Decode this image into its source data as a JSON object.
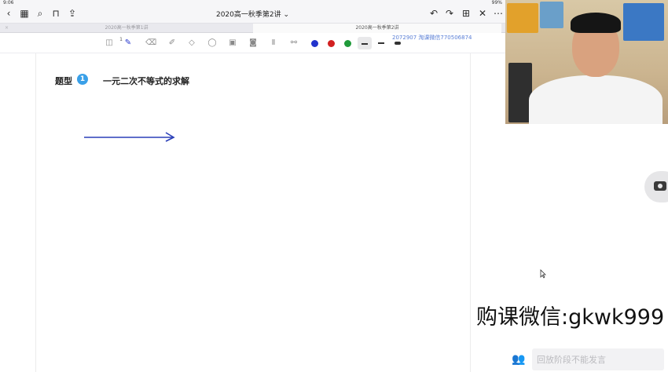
{
  "status": {
    "time": "9:06",
    "battery": "99%"
  },
  "nav": {
    "back_icon": "chevron-left-icon",
    "doc_title": "2020高一秋季第2讲 ⌄"
  },
  "tabs": [
    {
      "label": "2020高一秋季第1讲",
      "close": "×"
    },
    {
      "label": "2020高一秋季第2讲"
    }
  ],
  "toolbar": {
    "badge": "1",
    "colors": [
      "#2233cc",
      "#d22020",
      "#1f9a3a"
    ],
    "active_color": "#2233cc"
  },
  "watermark": "2072907 淘课微信770506874",
  "content": {
    "heading_prefix": "题型",
    "heading_number": "1",
    "heading_text": "一元二次不等式的求解",
    "arrow_color": "#2a3fb8"
  },
  "promo": {
    "text": "购课微信:gkwk999"
  },
  "chat": {
    "placeholder": "回放阶段不能发言"
  }
}
